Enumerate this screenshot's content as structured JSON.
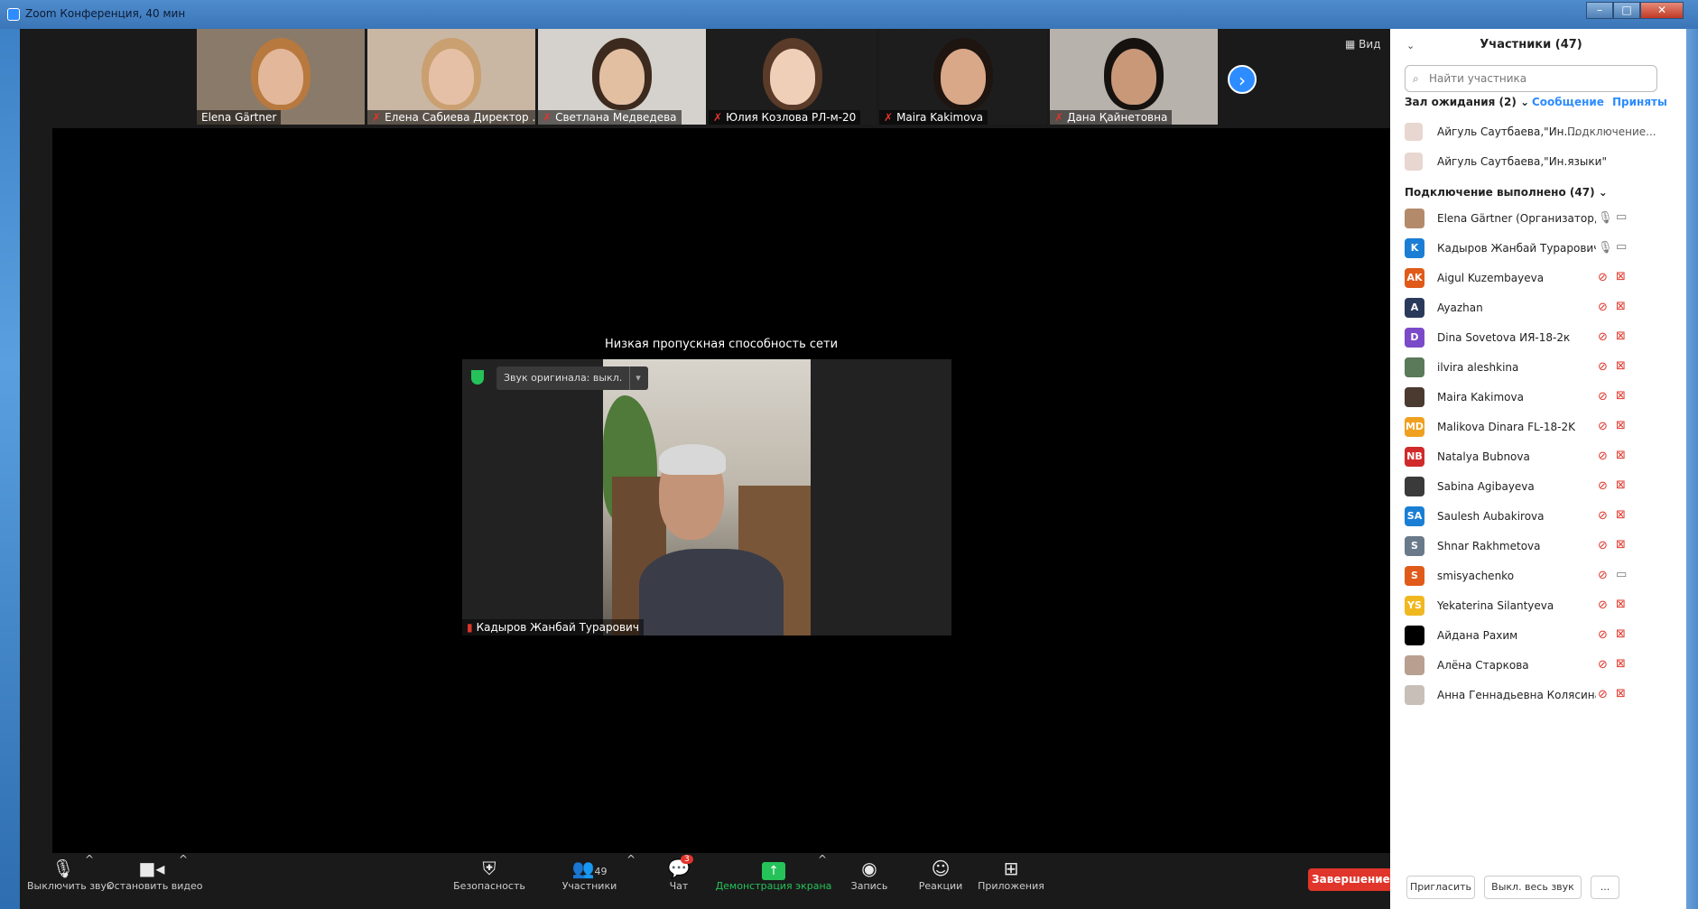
{
  "window": {
    "title": "Zoom Конференция, 40 мин",
    "controls": [
      "–",
      "□",
      "✕"
    ]
  },
  "top_strip": {
    "view_label": "Вид",
    "participants": [
      {
        "name": "Elena Gärtner",
        "muted": false,
        "bg": "#8a7a6a",
        "skin": "#e2b79a",
        "hair": "#b8793e"
      },
      {
        "name": "Елена Сабиева Директор ...",
        "muted": true,
        "bg": "#c9b7a4",
        "skin": "#e6c0a6",
        "hair": "#caa070"
      },
      {
        "name": "Светлана Медведева",
        "muted": true,
        "bg": "#d5d2cd",
        "skin": "#e3bfa2",
        "hair": "#3d2a1e"
      },
      {
        "name": "Юлия Козлова РЛ-м-20",
        "muted": true,
        "bg": "#1d1d1d",
        "skin": "#f0cfb8",
        "hair": "#5a3a28"
      },
      {
        "name": "Maira Kakimova",
        "muted": true,
        "bg": "#1d1d1d",
        "skin": "#d9a888",
        "hair": "#1e1410"
      },
      {
        "name": "Дана Қайнетовна",
        "muted": true,
        "bg": "#b8b2ad",
        "skin": "#c99878",
        "hair": "#161210"
      }
    ]
  },
  "main": {
    "network_warning": "Низкая пропускная способность сети",
    "original_sound": "Звук оригинала: выкл.",
    "speaker_name": "Кадыров Жанбай Турарович"
  },
  "toolbar": {
    "mute": "Выключить звук",
    "stop_video": "Остановить видео",
    "security": "Безопасность",
    "participants": "Участники",
    "participants_count": "49",
    "chat": "Чат",
    "chat_badge": "3",
    "share": "Демонстрация экрана",
    "record": "Запись",
    "reactions": "Реакции",
    "apps": "Приложения",
    "end": "Завершение"
  },
  "panel": {
    "title": "Участники (47)",
    "search_placeholder": "Найти участника",
    "waiting_header": "Зал ожидания (2)",
    "message": "Сообщение",
    "admit": "Приняты",
    "waiting": [
      {
        "name": "Айгуль Саутбаева,\"Ин....",
        "status": "Подключение..."
      },
      {
        "name": "Айгуль Саутбаева,\"Ин.языки\"",
        "status": ""
      }
    ],
    "connected_header": "Подключение выполнено (47)",
    "people": [
      {
        "name": "Elena Gärtner (Организатор, я)",
        "initials": "",
        "color": "#b38a6a",
        "mic": "on",
        "cam": "on"
      },
      {
        "name": "Кадыров Жанбай Турарович",
        "initials": "K",
        "color": "#1a7fd4",
        "mic": "on",
        "cam": "on"
      },
      {
        "name": "Aigul Kuzembayeva",
        "initials": "AK",
        "color": "#e05a1a",
        "mic": "off",
        "cam": "off"
      },
      {
        "name": "Ayazhan",
        "initials": "A",
        "color": "#2a3a5a",
        "mic": "off",
        "cam": "off"
      },
      {
        "name": "Dina Sovetova ИЯ-18-2к",
        "initials": "D",
        "color": "#7a4ac8",
        "mic": "off",
        "cam": "off"
      },
      {
        "name": "ilvira aleshkina",
        "initials": "",
        "color": "#5a7a5a",
        "mic": "off",
        "cam": "off"
      },
      {
        "name": "Maira Kakimova",
        "initials": "",
        "color": "#4a3a30",
        "mic": "off",
        "cam": "off"
      },
      {
        "name": "Malikova Dinara FL-18-2K",
        "initials": "MD",
        "color": "#f0a020",
        "mic": "off",
        "cam": "off"
      },
      {
        "name": "Natalya Bubnova",
        "initials": "NB",
        "color": "#d02a2a",
        "mic": "off",
        "cam": "off"
      },
      {
        "name": "Sabina Agibayeva",
        "initials": "",
        "color": "#3a3a3a",
        "mic": "off",
        "cam": "off"
      },
      {
        "name": "Saulesh Aubakirova",
        "initials": "SA",
        "color": "#1a7fd4",
        "mic": "off",
        "cam": "off"
      },
      {
        "name": "Shnar Rakhmetova",
        "initials": "S",
        "color": "#6a7a8a",
        "mic": "off",
        "cam": "off"
      },
      {
        "name": "smisyachenko",
        "initials": "S",
        "color": "#e05a1a",
        "mic": "off",
        "cam": "on"
      },
      {
        "name": "Yekaterina Silantyeva",
        "initials": "YS",
        "color": "#f0b820",
        "mic": "off",
        "cam": "off"
      },
      {
        "name": "Айдана Рахим",
        "initials": "",
        "color": "#000000",
        "mic": "off",
        "cam": "off"
      },
      {
        "name": "Алёна Старкова",
        "initials": "",
        "color": "#b8a090",
        "mic": "off",
        "cam": "off"
      },
      {
        "name": "Анна Геннадьевна Колясина",
        "initials": "",
        "color": "#c8c0b8",
        "mic": "off",
        "cam": "off"
      }
    ],
    "invite": "Пригласить",
    "mute_all": "Выкл. весь звук",
    "more": "..."
  }
}
